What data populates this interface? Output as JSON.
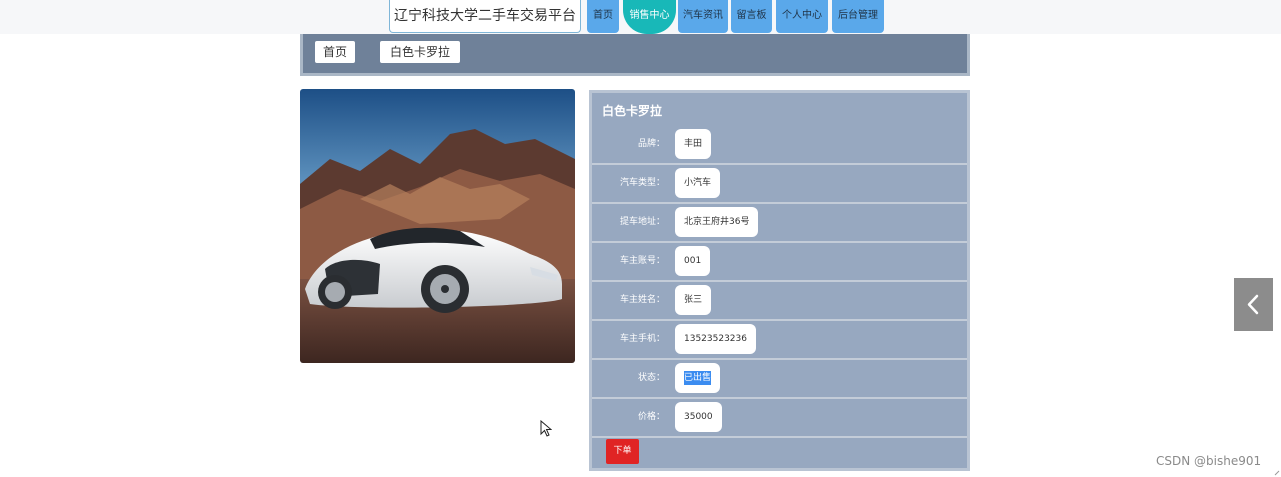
{
  "header": {
    "site_title": "辽宁科技大学二手车交易平台",
    "nav": [
      {
        "label": "首页",
        "active": false
      },
      {
        "label": "销售中心",
        "active": true
      },
      {
        "label": "汽车资讯",
        "active": false
      },
      {
        "label": "留言板",
        "active": false
      },
      {
        "label": "个人中心",
        "active": false
      },
      {
        "label": "后台管理",
        "active": false
      }
    ]
  },
  "breadcrumb": {
    "home": "首页",
    "current": "白色卡罗拉"
  },
  "detail": {
    "title": "白色卡罗拉",
    "fields": [
      {
        "label": "品牌：",
        "value": "丰田"
      },
      {
        "label": "汽车类型：",
        "value": "小汽车"
      },
      {
        "label": "提车地址：",
        "value": "北京王府井36号"
      },
      {
        "label": "车主账号：",
        "value": "001"
      },
      {
        "label": "车主姓名：",
        "value": "张三"
      },
      {
        "label": "车主手机：",
        "value": "13523523236"
      },
      {
        "label": "状态：",
        "value": "已出售"
      },
      {
        "label": "价格：",
        "value": "35000"
      }
    ],
    "order_button": "下单"
  },
  "icons": {
    "side_tab": "chevron-left-icon",
    "cursor": "mouse-pointer-icon"
  },
  "watermark": "CSDN @bishe901",
  "colors": {
    "nav": "#5aa8ea",
    "nav_active": "#18b8b8",
    "panel": "#97a8c0",
    "order_button": "#e02424"
  }
}
